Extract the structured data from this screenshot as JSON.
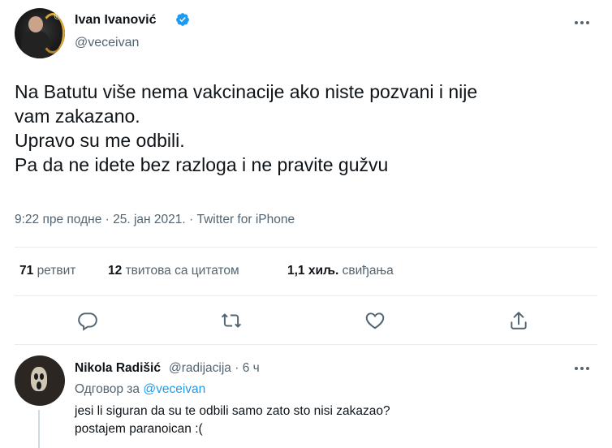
{
  "tweet": {
    "author_name": "Ivan Ivanović",
    "author_handle": "@veceivan",
    "lines": [
      "Na Batutu više nema vakcinacije ako niste pozvani i nije",
      "vam zakazano.",
      "Upravo su me odbili.",
      "Pa da ne idete bez razloga i ne pravite gužvu"
    ],
    "time": "9:22 пре подне",
    "date": "25. јан 2021.",
    "source": "Twitter for iPhone",
    "separator": "·"
  },
  "stats": {
    "retweets_count": "71",
    "retweets_label": "ретвит",
    "quotes_count": "12",
    "quotes_label": "твитова са цитатом",
    "likes_count": "1,1 хиљ.",
    "likes_label": "свиђања"
  },
  "actions": [
    "reply-icon",
    "retweet-icon",
    "like-icon",
    "share-icon"
  ],
  "reply": {
    "author_name": "Nikola Radišić",
    "author_handle": "@radijacija",
    "separator": "·",
    "age": "6 ч",
    "replying_to_label": "Одговор за",
    "replying_to_handle": "@veceivan",
    "lines": [
      "jesi li siguran da su te odbili samo zato sto nisi zakazao?",
      "postajem paranoican :("
    ]
  },
  "colors": {
    "text": "#0f1419",
    "secondary": "#536471",
    "accent": "#1d9bf0",
    "divider": "#e6ecf0"
  }
}
